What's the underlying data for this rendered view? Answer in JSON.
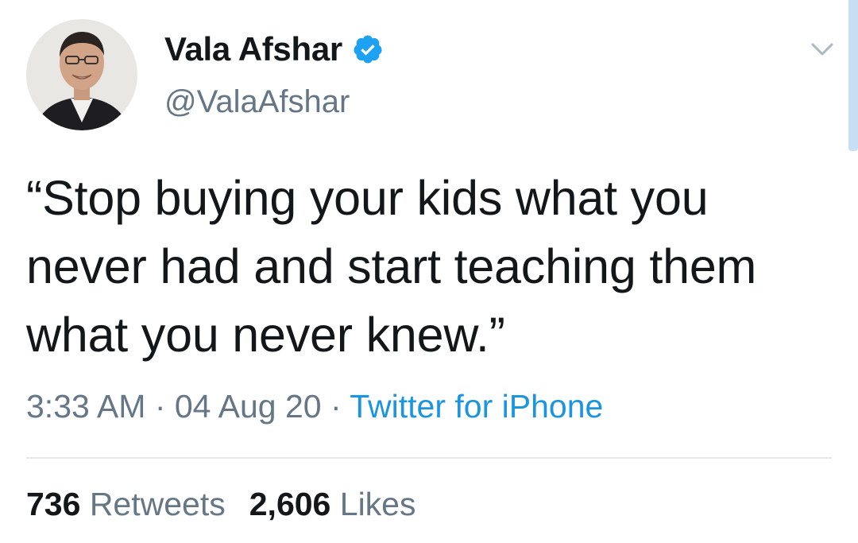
{
  "author": {
    "display_name": "Vala Afshar",
    "handle": "@ValaAfshar",
    "verified": true,
    "verified_icon": "verified-badge-icon",
    "avatar": "avatar-photo"
  },
  "tweet": {
    "text": "“Stop buying your kids what you never had and start teaching them what you never knew.”",
    "time": "3:33 AM",
    "separator1": " · ",
    "date": "04 Aug 20",
    "separator2": " · ",
    "source": "Twitter for iPhone"
  },
  "stats": {
    "retweets_count": "736",
    "retweets_label": "Retweets",
    "likes_count": "2,606",
    "likes_label": "Likes"
  },
  "menu_icon": "chevron-down-icon",
  "colors": {
    "text": "#14171a",
    "secondary": "#657786",
    "link": "#1b95e0",
    "verified": "#1da1f2",
    "divider": "#e1e8ed",
    "scrollbar": "#c6dff2"
  }
}
